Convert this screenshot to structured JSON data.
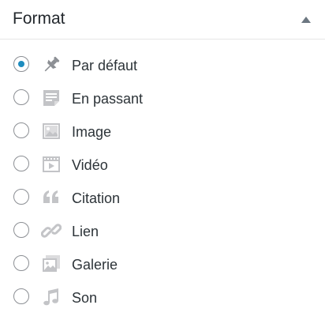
{
  "panel": {
    "title": "Format",
    "toggle_icon": "triangle-up-icon"
  },
  "formats": [
    {
      "label": "Par défaut",
      "icon": "pushpin-icon",
      "selected": true
    },
    {
      "label": "En passant",
      "icon": "aside-note-icon",
      "selected": false
    },
    {
      "label": "Image",
      "icon": "image-icon",
      "selected": false
    },
    {
      "label": "Vidéo",
      "icon": "video-icon",
      "selected": false
    },
    {
      "label": "Citation",
      "icon": "quote-icon",
      "selected": false
    },
    {
      "label": "Lien",
      "icon": "link-icon",
      "selected": false
    },
    {
      "label": "Galerie",
      "icon": "gallery-icon",
      "selected": false
    },
    {
      "label": "Son",
      "icon": "music-note-icon",
      "selected": false
    }
  ],
  "colors": {
    "accent": "#1e8cbe",
    "icon_light": "#c3c4c7",
    "icon_dark": "#8c8f94"
  }
}
